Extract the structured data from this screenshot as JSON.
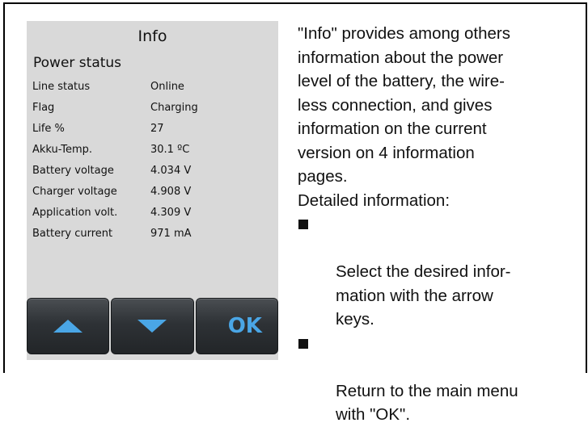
{
  "screen": {
    "title": "Info",
    "section_title": "Power status",
    "rows": [
      {
        "label": "Line status",
        "value": "Online"
      },
      {
        "label": "Flag",
        "value": "Charging"
      },
      {
        "label": "Life %",
        "value": "27"
      },
      {
        "label": "Akku-Temp.",
        "value": "30.1 ºC"
      },
      {
        "label": "Battery voltage",
        "value": "4.034 V"
      },
      {
        "label": "Charger voltage",
        "value": "4.908 V"
      },
      {
        "label": "Application volt.",
        "value": "4.309 V"
      },
      {
        "label": "Battery current",
        "value": "971 mA"
      }
    ],
    "buttons": {
      "up_icon": "arrow-up-icon",
      "down_icon": "arrow-down-icon",
      "ok_label": "OK"
    },
    "accent_color": "#4aa6e6",
    "background_color": "#d9d9d9"
  },
  "description": {
    "intro": "\"Info\" provides among others\ninformation about the power\nlevel of the battery, the wire-\nless connection, and gives\ninformation on the current\nversion on 4 information\npages.",
    "detail_heading": "Detailed information:",
    "bullets": [
      "Select the desired infor-\nmation with the arrow\nkeys.",
      "Return to the main menu\nwith \"OK\"."
    ]
  }
}
